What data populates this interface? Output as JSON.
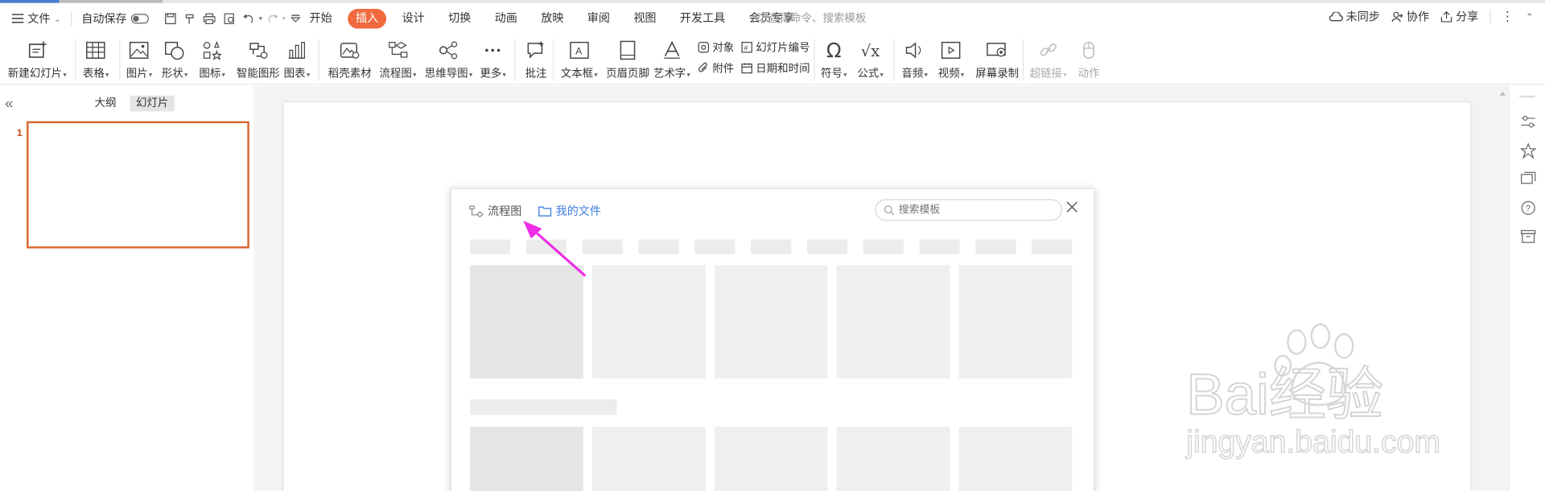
{
  "menubar": {
    "file_label": "文件",
    "autosave_label": "自动保存",
    "tabs": [
      "开始",
      "插入",
      "设计",
      "切换",
      "动画",
      "放映",
      "审阅",
      "视图",
      "开发工具",
      "会员专享"
    ],
    "search_placeholder": "查找命令、搜索模板",
    "right": {
      "sync_label": "未同步",
      "collab_label": "协作",
      "share_label": "分享"
    }
  },
  "ribbon": {
    "new_slide": "新建幻灯片",
    "table": "表格",
    "picture": "图片",
    "shape": "形状",
    "icon": "图标",
    "smart_graphic": "智能图形",
    "chart": "图表",
    "docer_material": "稻壳素材",
    "flowchart": "流程图",
    "mindmap": "思维导图",
    "more": "更多",
    "comment": "批注",
    "textbox": "文本框",
    "header_footer": "页眉页脚",
    "wordart": "艺术字",
    "object": "对象",
    "slide_number": "幻灯片编号",
    "attachment": "附件",
    "date_time": "日期和时间",
    "symbol": "符号",
    "formula": "公式",
    "audio": "音频",
    "video": "视频",
    "screen_record": "屏幕录制",
    "hyperlink": "超链接",
    "action": "动作"
  },
  "left_panel": {
    "tab_outline": "大纲",
    "tab_slides": "幻灯片",
    "slide_number": "1"
  },
  "dialog": {
    "tab_flowchart": "流程图",
    "tab_myfiles": "我的文件",
    "search_placeholder": "搜索模板"
  },
  "watermark": {
    "brand": "Bai经验",
    "url": "jingyan.baidu.com"
  },
  "colors": {
    "accent": "#f06a3e",
    "link_blue": "#3f7fe0",
    "arrow_magenta": "#ee2ee6",
    "slide_border": "#d7662e"
  }
}
